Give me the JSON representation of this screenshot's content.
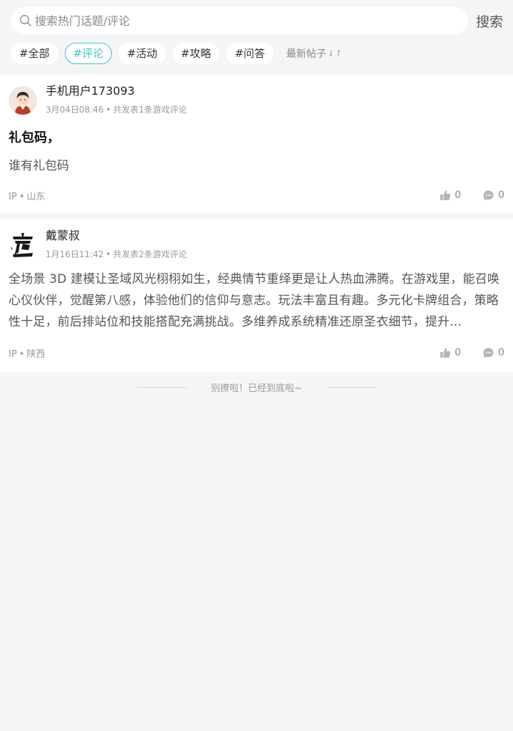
{
  "search": {
    "placeholder": "搜索热门话题/评论",
    "button_label": "搜索"
  },
  "filters": {
    "tags": [
      {
        "label": "#全部",
        "active": false
      },
      {
        "label": "#评论",
        "active": true
      },
      {
        "label": "#活动",
        "active": false
      },
      {
        "label": "#攻略",
        "active": false
      },
      {
        "label": "#问答",
        "active": false
      }
    ],
    "sort_label": "最新帖子",
    "sort_icon": "sort-arrows-icon"
  },
  "posts": [
    {
      "username": "手机用户173093",
      "date": "3月04日08:46",
      "post_count": "共发表1条游戏评论",
      "title": "礼包码，",
      "body": "谁有礼包码",
      "ip_label": "IP",
      "ip_region": "山东",
      "likes": "0",
      "comments": "0"
    },
    {
      "username": "戴蒙叔",
      "date": "1月16日11:42",
      "post_count": "共发表2条游戏评论",
      "title": "",
      "body": "全场景 3D 建模让圣域风光栩栩如生，经典情节重绎更是让人热血沸腾。在游戏里，能召唤心仪伙伴，觉醒第八感，体验他们的信仰与意志。玩法丰富且有趣。多元化卡牌组合，策略性十足，前后排站位和技能搭配充满挑战。多维养成系统精准还原圣衣细节，提升...",
      "ip_label": "IP",
      "ip_region": "陕西",
      "likes": "0",
      "comments": "0"
    }
  ],
  "footer": {
    "end_text": "别撩啦！已经到底啦~"
  },
  "colors": {
    "accent": "#41c3c9",
    "background": "#f4f5f7"
  }
}
